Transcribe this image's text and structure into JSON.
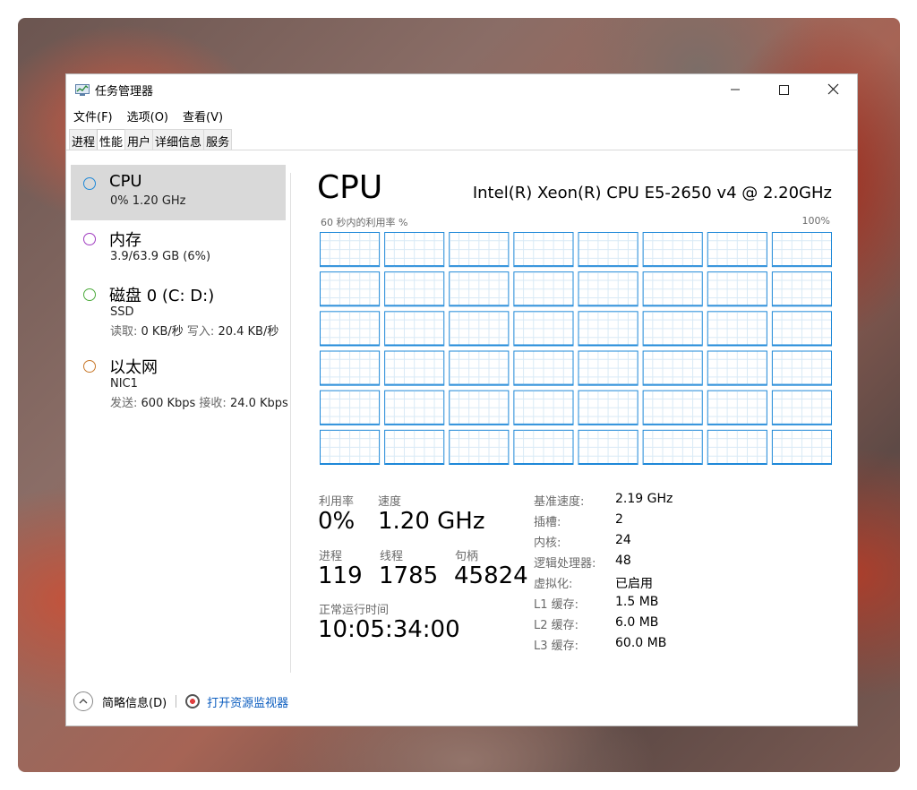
{
  "window": {
    "title": "任务管理器",
    "icons": {
      "app": "task-manager-icon",
      "minimize": "minimize-icon",
      "maximize": "maximize-icon",
      "close": "close-icon"
    }
  },
  "menu": [
    "文件(F)",
    "选项(O)",
    "查看(V)"
  ],
  "tabs": [
    {
      "label": "进程",
      "active": false
    },
    {
      "label": "性能",
      "active": true
    },
    {
      "label": "用户",
      "active": false
    },
    {
      "label": "详细信息",
      "active": false
    },
    {
      "label": "服务",
      "active": false
    }
  ],
  "sidebar": {
    "items": [
      {
        "title": "CPU",
        "sub1": "0% 1.20 GHz",
        "color": "#1e88d8"
      },
      {
        "title": "内存",
        "sub1": "3.9/63.9 GB (6%)",
        "color": "#a03cc0"
      },
      {
        "title": "磁盘 0 (C: D:)",
        "sub1": "SSD",
        "sub2_label_a": "读取:",
        "sub2_value_a": "0 KB/秒",
        "sub2_label_b": "写入:",
        "sub2_value_b": "20.4 KB/秒",
        "color": "#4caa3c"
      },
      {
        "title": "以太网",
        "sub1": "NIC1",
        "sub2_label_a": "发送:",
        "sub2_value_a": "600 Kbps",
        "sub2_label_b": "接收:",
        "sub2_value_b": "24.0 Kbps",
        "color": "#c8782a"
      }
    ]
  },
  "cpu": {
    "heading": "CPU",
    "model": "Intel(R) Xeon(R) CPU E5-2650 v4 @ 2.20GHz",
    "graph_label": "60 秒内的利用率 %",
    "graph_max": "100%",
    "cores": 48,
    "accent": "#1e88d8",
    "stats": {
      "util_label": "利用率",
      "util_value": "0%",
      "speed_label": "速度",
      "speed_value": "1.20 GHz",
      "proc_label": "进程",
      "proc_value": "119",
      "thread_label": "线程",
      "thread_value": "1785",
      "handle_label": "句柄",
      "handle_value": "45824",
      "uptime_label": "正常运行时间",
      "uptime_value": "10:05:34:00"
    },
    "specs": [
      {
        "k": "基准速度:",
        "v": "2.19 GHz"
      },
      {
        "k": "插槽:",
        "v": "2"
      },
      {
        "k": "内核:",
        "v": "24"
      },
      {
        "k": "逻辑处理器:",
        "v": "48"
      },
      {
        "k": "虚拟化:",
        "v": "已启用"
      },
      {
        "k": "L1 缓存:",
        "v": "1.5 MB"
      },
      {
        "k": "L2 缓存:",
        "v": "6.0 MB"
      },
      {
        "k": "L3 缓存:",
        "v": "60.0 MB"
      }
    ]
  },
  "footer": {
    "summary_label": "简略信息(D)",
    "monitor_label": "打开资源监视器"
  }
}
